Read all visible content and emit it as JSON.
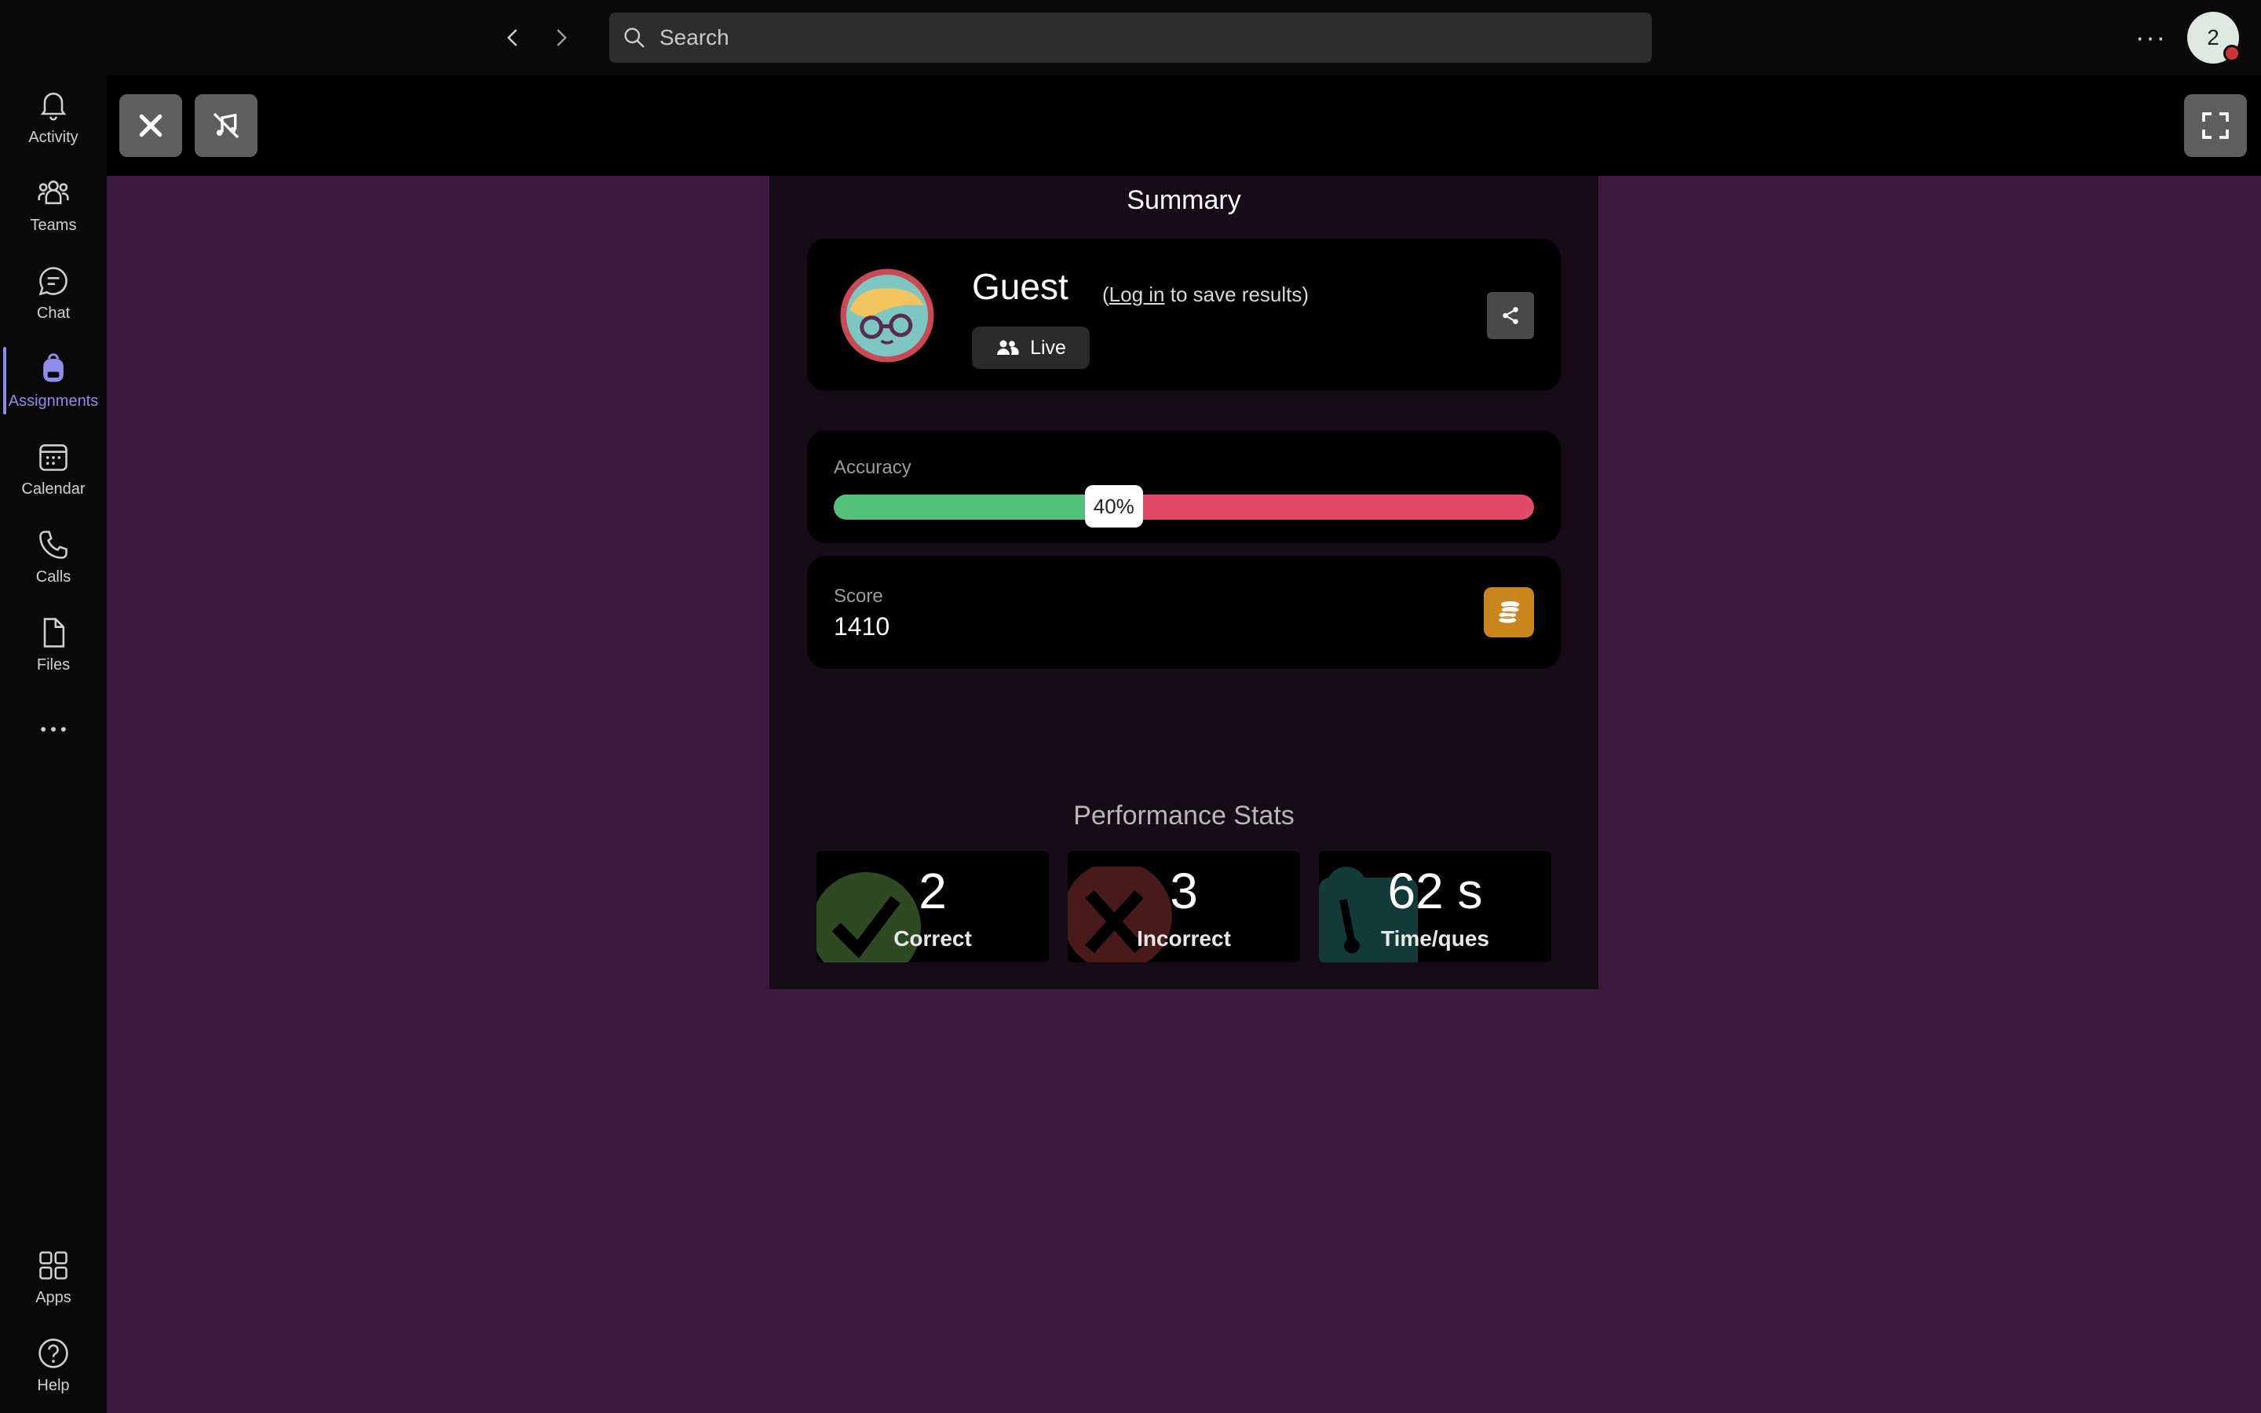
{
  "topbar": {
    "back_icon": "chevron-left-icon",
    "forward_icon": "chevron-right-icon",
    "search_placeholder": "Search",
    "more_label": "···",
    "avatar_initial": "2"
  },
  "rail": {
    "items": [
      {
        "label": "Activity",
        "icon": "bell-icon"
      },
      {
        "label": "Teams",
        "icon": "teams-icon"
      },
      {
        "label": "Chat",
        "icon": "chat-icon"
      },
      {
        "label": "Assignments",
        "icon": "backpack-icon",
        "active": true
      },
      {
        "label": "Calendar",
        "icon": "calendar-icon"
      },
      {
        "label": "Calls",
        "icon": "phone-icon"
      },
      {
        "label": "Files",
        "icon": "file-icon"
      },
      {
        "label": "",
        "icon": "more-icon"
      }
    ],
    "bottom": [
      {
        "label": "Apps",
        "icon": "apps-icon"
      },
      {
        "label": "Help",
        "icon": "help-icon"
      }
    ]
  },
  "toolbar": {
    "close_icon": "close-icon",
    "music_off_icon": "music-off-icon",
    "fullscreen_icon": "fullscreen-icon"
  },
  "summary": {
    "title": "Summary",
    "guest_name": "Guest",
    "note_prefix": "(",
    "login_link": "Log in",
    "note_suffix": " to save results)",
    "mode_label": "Live",
    "accuracy_label": "Accuracy",
    "accuracy_text": "40%",
    "accuracy_fraction": 0.4,
    "score_label": "Score",
    "score_value": "1410",
    "perf_title": "Performance Stats",
    "stats": [
      {
        "value": "2",
        "label": "Correct",
        "icon": "check-icon",
        "color": "#2e4a22"
      },
      {
        "value": "3",
        "label": "Incorrect",
        "icon": "cross-icon",
        "color": "#4a1a1a"
      },
      {
        "value": "62 s",
        "label": "Time/ques",
        "icon": "timer-icon",
        "color": "#133a3a"
      }
    ]
  },
  "colors": {
    "accent": "#8b8de8",
    "purple_bg": "#3d1b3e",
    "accuracy_correct": "#55c07c",
    "accuracy_incorrect": "#e24a68",
    "coin": "#c9861f"
  }
}
